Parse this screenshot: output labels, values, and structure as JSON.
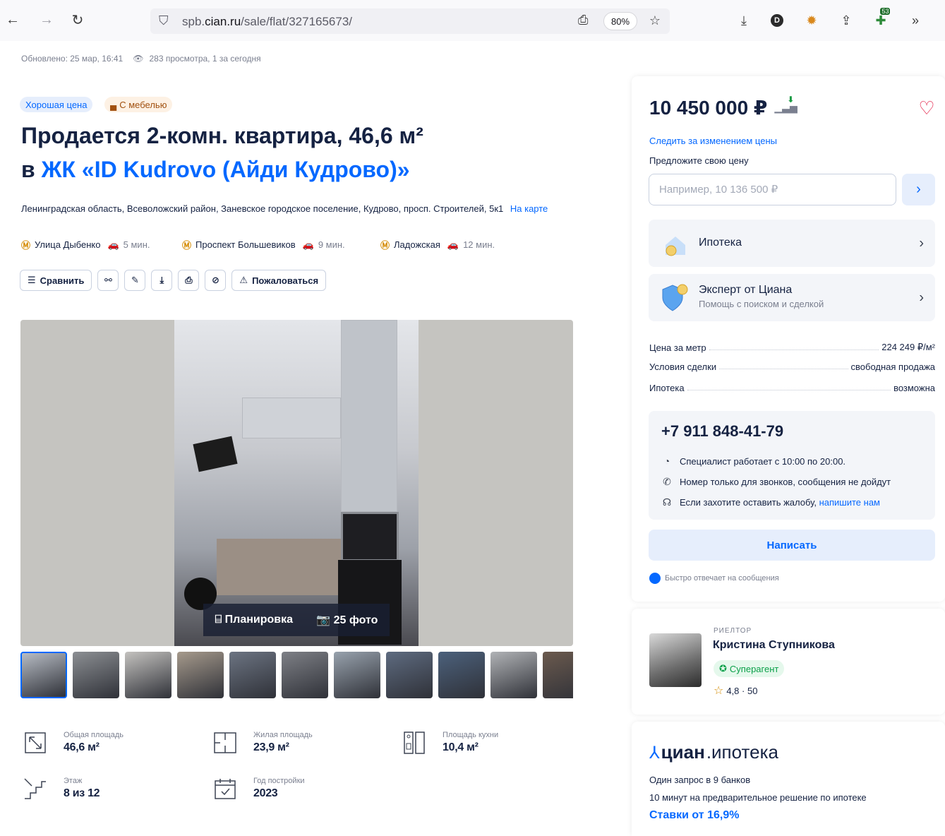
{
  "browser": {
    "url_prefix": "spb.",
    "url_domain": "cian.ru",
    "url_path": "/sale/flat/327165673/",
    "zoom": "80%",
    "tab_count_badge": "53"
  },
  "meta": {
    "updated": "Обновлено: 25 мар, 16:41",
    "views": "283 просмотра, 1 за сегодня"
  },
  "badges": {
    "good_price": "Хорошая цена",
    "furniture": "С мебелью"
  },
  "title": {
    "line1_prefix": "Продается 2-комн. квартира, 46,6 м²",
    "line2_prefix": "в ",
    "line2_link": "ЖК «ID Kudrovo (Айди Кудрово)»"
  },
  "address": {
    "text": "Ленинградская область, Всеволожский район, Заневское городское поселение, Кудрово, просп. Строителей, 5к1",
    "map_link": "На карте"
  },
  "metro": [
    {
      "name": "Улица Дыбенко",
      "time": "5 мин."
    },
    {
      "name": "Проспект Большевиков",
      "time": "9 мин."
    },
    {
      "name": "Ладожская",
      "time": "12 мин."
    }
  ],
  "actions": {
    "compare": "Сравнить",
    "complain": "Пожаловаться"
  },
  "gallery": {
    "plan": "Планировка",
    "photos": "25 фото",
    "thumb_colors": [
      "#b7bcc4",
      "#8c8f93",
      "#c4c2bf",
      "#a69a8c",
      "#6c7482",
      "#7e8086",
      "#98a2ad",
      "#5e6b80",
      "#4c617c",
      "#b1b3b6",
      "#6b5a4e"
    ]
  },
  "features": {
    "total_area": {
      "label": "Общая площадь",
      "value": "46,6 м²"
    },
    "living_area": {
      "label": "Жилая площадь",
      "value": "23,9 м²"
    },
    "kitchen_area": {
      "label": "Площадь кухни",
      "value": "10,4 м²"
    },
    "floor": {
      "label": "Этаж",
      "value": "8 из 12"
    },
    "year": {
      "label": "Год постройки",
      "value": "2023"
    }
  },
  "sidebar": {
    "price": "10 450 000 ₽",
    "track_price": "Следить за изменением цены",
    "offer_label": "Предложите свою цену",
    "offer_placeholder": "Например, 10 136 500 ₽",
    "mortgage": "Ипотека",
    "expert_title": "Эксперт от Циана",
    "expert_sub": "Помощь с поиском и сделкой",
    "kv": [
      {
        "k": "Цена за метр",
        "v": "224 249 ₽/м²"
      },
      {
        "k": "Условия сделки",
        "v": "свободная продажа"
      },
      {
        "k": "Ипотека",
        "v": "возможна"
      }
    ],
    "phone": "+7 911 848-41-79",
    "hours": "Специалист работает с 10:00 по 20:00.",
    "calls_only": "Номер только для звонков, сообщения не дойдут",
    "complaint_prefix": "Если захотите оставить жалобу, ",
    "complaint_link": "напишите нам",
    "write": "Написать",
    "fast_reply": "Быстро отвечает на сообщения"
  },
  "realtor": {
    "tag": "РИЕЛТОР",
    "name": "Кристина Ступникова",
    "status": "Суперагент",
    "rating": "4,8 · 50"
  },
  "cian_mortgage": {
    "brand": "циан",
    "brand_suffix": ".ипотека",
    "line1": "Один запрос в 9 банков",
    "line2": "10 минут на предварительное решение по ипотеке",
    "rates": "Ставки от 16,9%"
  }
}
